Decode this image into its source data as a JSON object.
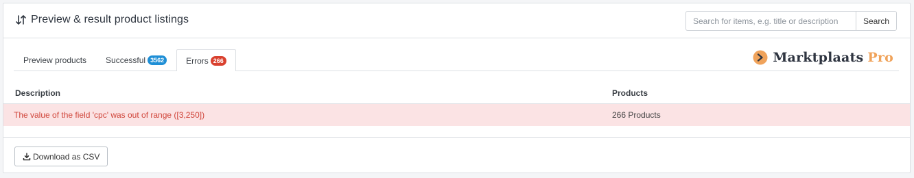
{
  "header": {
    "title": "Preview & result product listings",
    "title_icon": "sort-arrows-icon",
    "search_placeholder": "Search for items, e.g. title or description",
    "search_value": "",
    "search_button_label": "Search"
  },
  "tabs": [
    {
      "label": "Preview products",
      "badge": null,
      "active": false
    },
    {
      "label": "Successful",
      "badge": "3562",
      "badge_color": "#1f8fd6",
      "active": false
    },
    {
      "label": "Errors",
      "badge": "266",
      "badge_color": "#d9412f",
      "active": true
    }
  ],
  "logo": {
    "name": "Marktplaats",
    "suffix": "Pro",
    "brand_color": "#f0a35b"
  },
  "table": {
    "headers": {
      "description": "Description",
      "products": "Products"
    },
    "rows": [
      {
        "description": "The value of the field 'cpc' was out of range ([3,250])",
        "products": "266 Products"
      }
    ]
  },
  "footer": {
    "download_label": "Download as CSV",
    "download_icon": "download-icon"
  }
}
